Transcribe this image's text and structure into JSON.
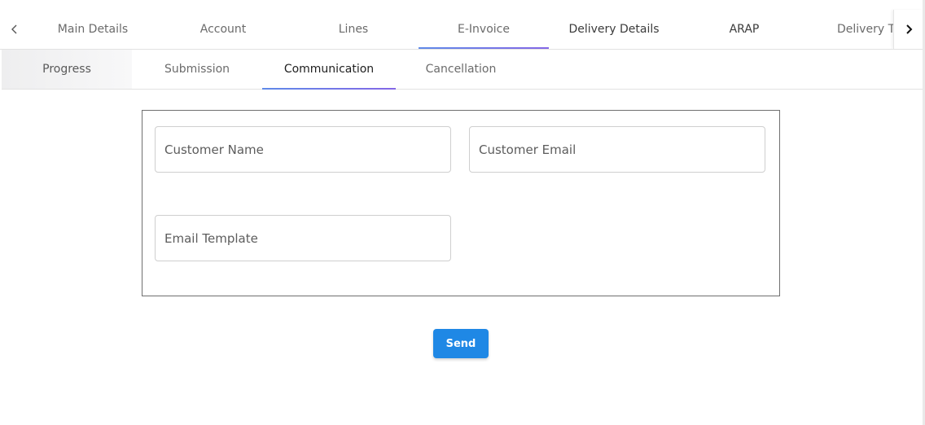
{
  "top_tabs": {
    "items": [
      {
        "label": "Main Details"
      },
      {
        "label": "Account"
      },
      {
        "label": "Lines"
      },
      {
        "label": "E-Invoice"
      },
      {
        "label": "Delivery Details"
      },
      {
        "label": "ARAP"
      },
      {
        "label": "Delivery Tr"
      }
    ],
    "active": "E-Invoice",
    "scroll_left_icon": "chevron-left-icon",
    "scroll_right_icon": "chevron-right-icon"
  },
  "sub_tabs": {
    "items": [
      {
        "label": "Progress"
      },
      {
        "label": "Submission"
      },
      {
        "label": "Communication"
      },
      {
        "label": "Cancellation"
      }
    ],
    "active": "Communication"
  },
  "form": {
    "customer_name": {
      "value": "",
      "placeholder": "Customer Name"
    },
    "customer_email": {
      "value": "",
      "placeholder": "Customer Email"
    },
    "email_template": {
      "value": "",
      "placeholder": "Email Template"
    }
  },
  "actions": {
    "send_label": "Send"
  },
  "colors": {
    "accent": "#1f88e5",
    "tab_indicator_start": "#5f8ae8",
    "tab_indicator_end": "#8467e6"
  }
}
